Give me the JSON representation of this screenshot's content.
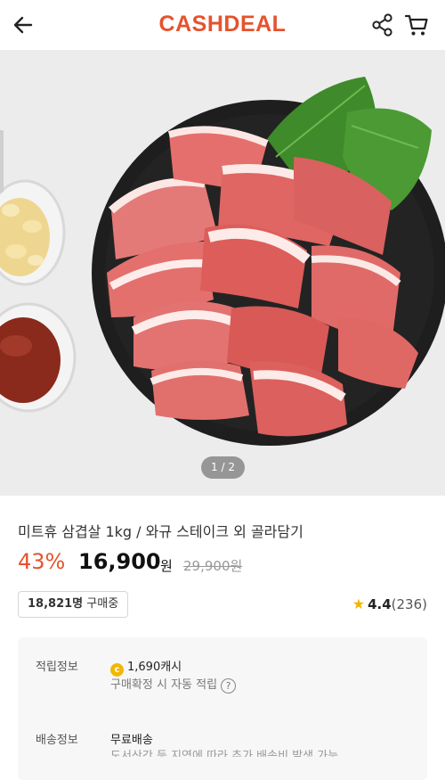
{
  "header": {
    "logo": "CASHDEAL",
    "logo_color": "#e5532d",
    "back_icon": "arrow-left-icon",
    "share_icon": "share-icon",
    "cart_icon": "cart-icon"
  },
  "gallery": {
    "pager": "1 / 2"
  },
  "product": {
    "title": "미트휴 삼겹살 1kg / 와규 스테이크 외 골라담기",
    "discount": "43%",
    "price": "16,900",
    "currency": "원",
    "original_price": "29,900원",
    "buyers_count": "18,821명",
    "buyers_suffix": "구매중",
    "rating": "4.4",
    "review_count": "(236)",
    "accent_color": "#e5532d"
  },
  "info": {
    "points_label": "적립정보",
    "points_value": "1,690캐시",
    "points_coin": "c",
    "points_note": "구매확정 시 자동 적립",
    "shipping_label": "배송정보",
    "shipping_value": "무료배송",
    "shipping_note": "도서산간 등 지역에 따라 추가 배송비 발생 가능"
  }
}
